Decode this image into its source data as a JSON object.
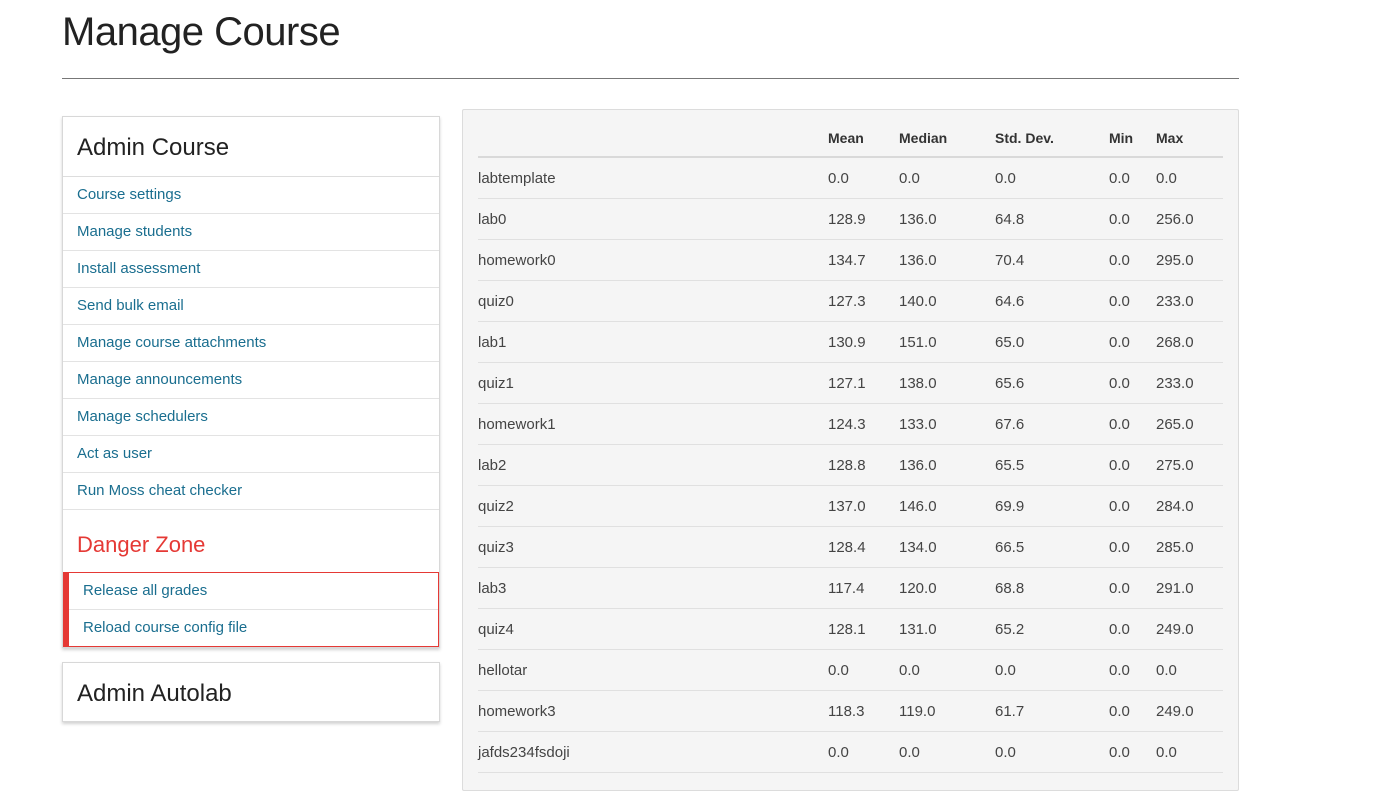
{
  "page": {
    "title": "Manage Course"
  },
  "admin_course": {
    "title": "Admin Course",
    "links": [
      "Course settings",
      "Manage students",
      "Install assessment",
      "Send bulk email",
      "Manage course attachments",
      "Manage announcements",
      "Manage schedulers",
      "Act as user",
      "Run Moss cheat checker"
    ],
    "danger_title": "Danger Zone",
    "danger_links": [
      "Release all grades",
      "Reload course config file"
    ]
  },
  "admin_autolab": {
    "title": "Admin Autolab"
  },
  "stats": {
    "headers": [
      "",
      "Mean",
      "Median",
      "Std. Dev.",
      "Min",
      "Max"
    ],
    "rows": [
      [
        "labtemplate",
        "0.0",
        "0.0",
        "0.0",
        "0.0",
        "0.0"
      ],
      [
        "lab0",
        "128.9",
        "136.0",
        "64.8",
        "0.0",
        "256.0"
      ],
      [
        "homework0",
        "134.7",
        "136.0",
        "70.4",
        "0.0",
        "295.0"
      ],
      [
        "quiz0",
        "127.3",
        "140.0",
        "64.6",
        "0.0",
        "233.0"
      ],
      [
        "lab1",
        "130.9",
        "151.0",
        "65.0",
        "0.0",
        "268.0"
      ],
      [
        "quiz1",
        "127.1",
        "138.0",
        "65.6",
        "0.0",
        "233.0"
      ],
      [
        "homework1",
        "124.3",
        "133.0",
        "67.6",
        "0.0",
        "265.0"
      ],
      [
        "lab2",
        "128.8",
        "136.0",
        "65.5",
        "0.0",
        "275.0"
      ],
      [
        "quiz2",
        "137.0",
        "146.0",
        "69.9",
        "0.0",
        "284.0"
      ],
      [
        "quiz3",
        "128.4",
        "134.0",
        "66.5",
        "0.0",
        "285.0"
      ],
      [
        "lab3",
        "117.4",
        "120.0",
        "68.8",
        "0.0",
        "291.0"
      ],
      [
        "quiz4",
        "128.1",
        "131.0",
        "65.2",
        "0.0",
        "249.0"
      ],
      [
        "hellotar",
        "0.0",
        "0.0",
        "0.0",
        "0.0",
        "0.0"
      ],
      [
        "homework3",
        "118.3",
        "119.0",
        "61.7",
        "0.0",
        "249.0"
      ],
      [
        "jafds234fsdoji",
        "0.0",
        "0.0",
        "0.0",
        "0.0",
        "0.0"
      ]
    ]
  },
  "colors": {
    "link": "#1a6e8f",
    "danger": "#e53935",
    "panel_bg": "#f5f5f5"
  }
}
